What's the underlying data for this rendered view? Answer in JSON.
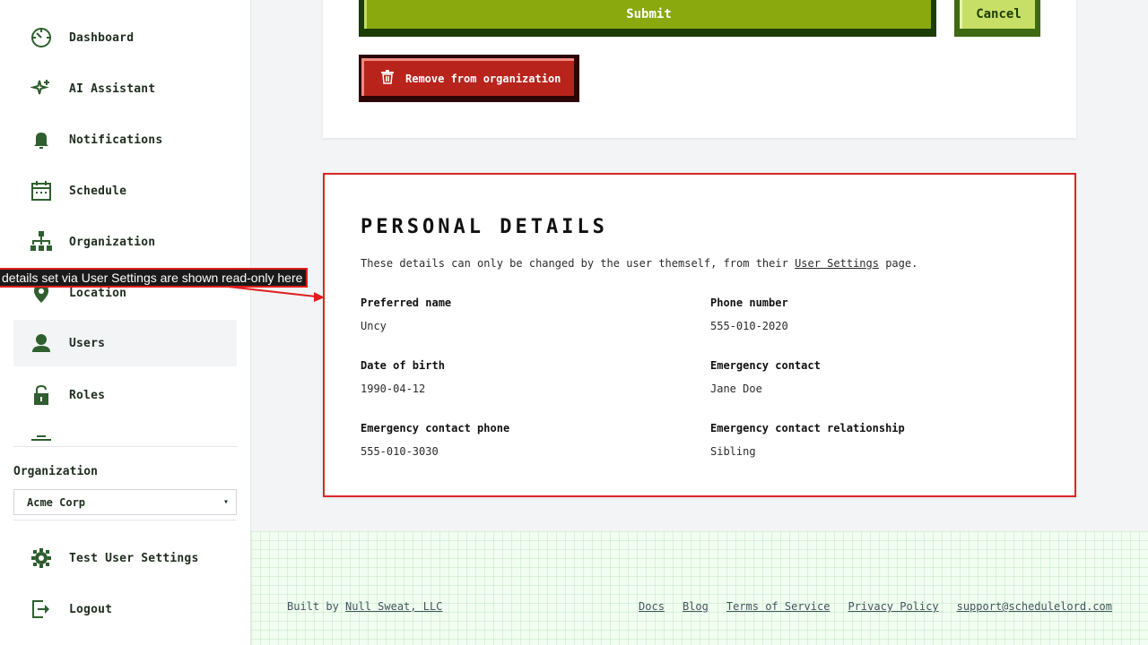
{
  "sidebar": {
    "items": [
      {
        "label": "Dashboard",
        "icon": "dashboard-icon"
      },
      {
        "label": "AI Assistant",
        "icon": "sparkle-icon"
      },
      {
        "label": "Notifications",
        "icon": "bell-icon"
      },
      {
        "label": "Schedule",
        "icon": "calendar-icon"
      },
      {
        "label": "Organization",
        "icon": "org-chart-icon"
      },
      {
        "label": "Location",
        "icon": "location-pin-icon"
      },
      {
        "label": "Users",
        "icon": "user-icon"
      },
      {
        "label": "Roles",
        "icon": "lock-icon"
      }
    ],
    "active_item": "Users",
    "org_label": "Organization",
    "org_selected": "Acme Corp",
    "bottom_items": [
      {
        "label": "Test User Settings",
        "icon": "gear-icon"
      },
      {
        "label": "Logout",
        "icon": "logout-icon"
      }
    ]
  },
  "actions": {
    "submit_label": "Submit",
    "cancel_label": "Cancel",
    "remove_label": "Remove from organization"
  },
  "personal_details": {
    "title": "Personal Details",
    "description_prefix": "These details can only be changed by the user themself, from their ",
    "description_link": "User Settings",
    "description_suffix": " page.",
    "fields": [
      {
        "label": "Preferred name",
        "value": "Uncy"
      },
      {
        "label": "Phone number",
        "value": "555-010-2020"
      },
      {
        "label": "Date of birth",
        "value": "1990-04-12"
      },
      {
        "label": "Emergency contact",
        "value": "Jane Doe"
      },
      {
        "label": "Emergency contact phone",
        "value": "555-010-3030"
      },
      {
        "label": "Emergency contact relationship",
        "value": "Sibling"
      }
    ]
  },
  "annotation": {
    "text": "details set via User Settings are shown read-only here"
  },
  "footer": {
    "built_prefix": "Built by ",
    "built_link": "Null Sweat, LLC",
    "links": [
      "Docs",
      "Blog",
      "Terms of Service",
      "Privacy Policy",
      "support@schedulelord.com"
    ]
  },
  "colors": {
    "brand_dark_green": "#1f4d1f",
    "submit_green": "#89a90e",
    "cancel_lime": "#c7df66",
    "danger_red": "#b8241c",
    "highlight_red": "#dc2626"
  }
}
